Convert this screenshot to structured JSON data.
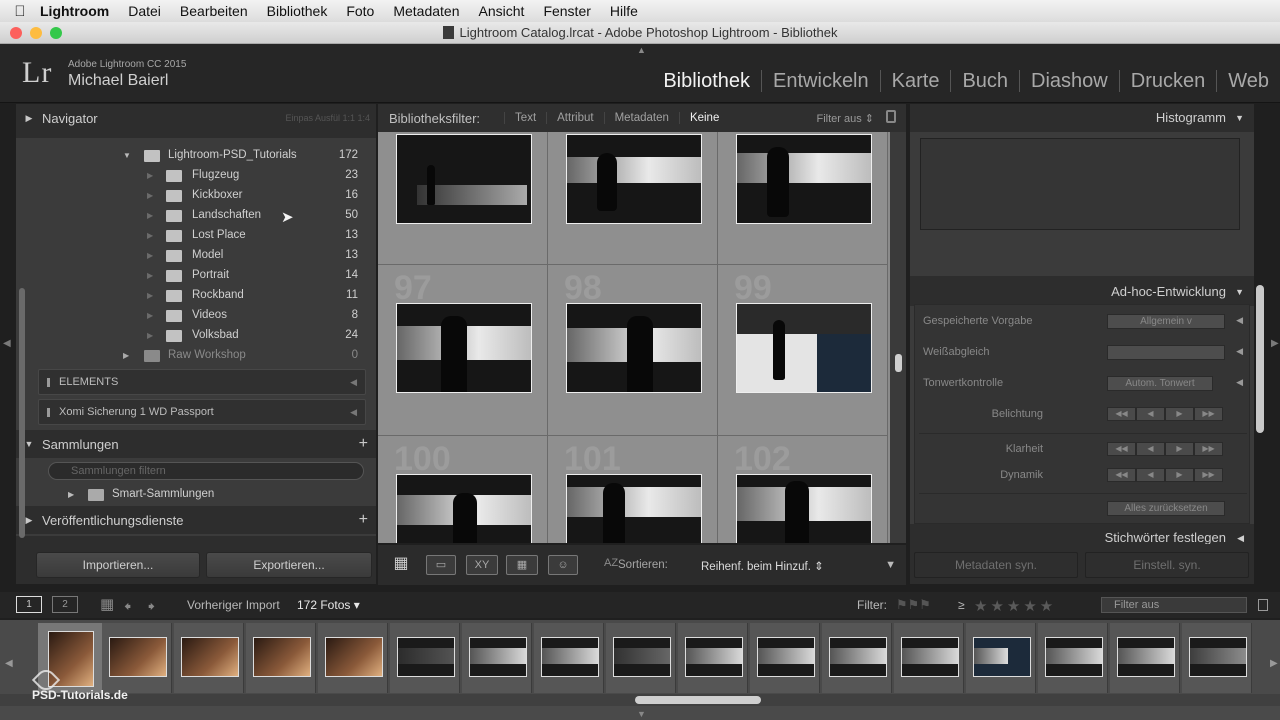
{
  "menubar": {
    "items": [
      "Lightroom",
      "Datei",
      "Bearbeiten",
      "Bibliothek",
      "Foto",
      "Metadaten",
      "Ansicht",
      "Fenster",
      "Hilfe"
    ]
  },
  "window": {
    "title": "Lightroom Catalog.lrcat - Adobe Photoshop Lightroom - Bibliothek",
    "traffic_lights": {
      "close": "#fc605c",
      "minimize": "#fdbc40",
      "zoom": "#34c84a"
    }
  },
  "identity": {
    "logo": "Lr",
    "product": "Adobe Lightroom CC 2015",
    "user": "Michael Baierl"
  },
  "modules": [
    "Bibliothek",
    "Entwickeln",
    "Karte",
    "Buch",
    "Diashow",
    "Drucken",
    "Web"
  ],
  "left_panel": {
    "navigator_title": "Navigator",
    "navigator_extra": "Einpas  Ausfül  1:1  1:4",
    "parent_folder": {
      "name": "Lightroom-PSD_Tutorials",
      "count": "172"
    },
    "folders": [
      {
        "name": "Flugzeug",
        "count": "23"
      },
      {
        "name": "Kickboxer",
        "count": "16"
      },
      {
        "name": "Landschaften",
        "count": "50"
      },
      {
        "name": "Lost Place",
        "count": "13"
      },
      {
        "name": "Model",
        "count": "13"
      },
      {
        "name": "Portrait",
        "count": "14"
      },
      {
        "name": "Rockband",
        "count": "11"
      },
      {
        "name": "Videos",
        "count": "8"
      },
      {
        "name": "Volksbad",
        "count": "24"
      }
    ],
    "other_folder": {
      "name": "Raw Workshop",
      "count": "0"
    },
    "volumes": [
      "ELEMENTS",
      "Xomi Sicherung 1 WD Passport"
    ],
    "collections_title": "Sammlungen",
    "collection_search_placeholder": "Sammlungen filtern",
    "smart_collections": "Smart-Sammlungen",
    "publish_title": "Veröffentlichungsdienste",
    "import_button": "Importieren...",
    "export_button": "Exportieren..."
  },
  "filterbar": {
    "label": "Bibliotheksfilter:",
    "tabs": [
      "Text",
      "Attribut",
      "Metadaten",
      "Keine"
    ],
    "active_tab": "Keine",
    "filter_off": "Filter aus"
  },
  "grid": {
    "cell_numbers": [
      "",
      "",
      "",
      "97",
      "98",
      "99",
      "100",
      "101",
      "102"
    ]
  },
  "toolbar": {
    "sort_label": "Sortieren:",
    "sort_value": "Reihenf. beim Hinzuf.",
    "sort_icon": "AZ",
    "compare_label": "XY"
  },
  "right_panel": {
    "histogram_title": "Histogramm",
    "quick_develop_title": "Ad-hoc-Entwicklung",
    "saved_preset_label": "Gespeicherte Vorgabe",
    "saved_preset_value": "Allgemein v",
    "white_balance_label": "Weißabgleich",
    "tone_control_label": "Tonwertkontrolle",
    "auto_tone_button": "Autom. Tonwert",
    "exposure_label": "Belichtung",
    "clarity_label": "Klarheit",
    "vibrance_label": "Dynamik",
    "reset_all_button": "Alles zurücksetzen",
    "keywording_title": "Stichwörter festlegen",
    "sync_metadata_button": "Metadaten syn.",
    "sync_settings_button": "Einstell. syn."
  },
  "filmstrip_bar": {
    "screen1": "1",
    "screen2": "2",
    "source": "Vorheriger Import",
    "count": "172 Fotos",
    "filter_label": "Filter:",
    "rating_operator": "≥",
    "filter_value": "Filter aus"
  },
  "watermark": "PSD-Tutorials.de"
}
